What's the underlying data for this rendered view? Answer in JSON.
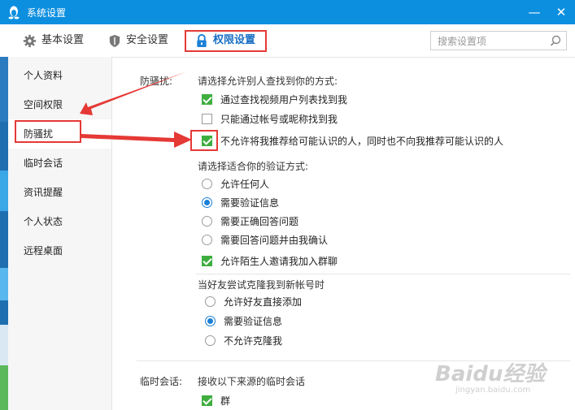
{
  "window": {
    "title": "系统设置",
    "minimize_glyph": "—",
    "close_glyph": "✕"
  },
  "toolbar": {
    "tabs": [
      {
        "label": "基本设置",
        "icon": "gear-icon"
      },
      {
        "label": "安全设置",
        "icon": "shield-icon"
      },
      {
        "label": "权限设置",
        "icon": "lock-icon"
      }
    ],
    "active_tab": 2
  },
  "search": {
    "placeholder": "搜索设置项",
    "value": ""
  },
  "sidebar": {
    "items": [
      {
        "label": "个人资料"
      },
      {
        "label": "空间权限"
      },
      {
        "label": "防骚扰"
      },
      {
        "label": "临时会话"
      },
      {
        "label": "资讯提醒"
      },
      {
        "label": "个人状态"
      },
      {
        "label": "远程桌面"
      }
    ],
    "selected": 2
  },
  "anti_harass": {
    "section_label": "防骚扰:",
    "find_prompt": "请选择允许别人查找到你的方式:",
    "find_options": [
      {
        "label": "通过查找视频用户列表找到我",
        "checked": true
      },
      {
        "label": "只能通过帐号或昵称找到我",
        "checked": false
      },
      {
        "label": "不允许将我推荐给可能认识的人，同时也不向我推荐可能认识的人",
        "checked": true
      }
    ],
    "verify_prompt": "请选择适合你的验证方式:",
    "verify_options": [
      {
        "label": "允许任何人",
        "selected": false
      },
      {
        "label": "需要验证信息",
        "selected": true
      },
      {
        "label": "需要正确回答问题",
        "selected": false
      },
      {
        "label": "需要回答问题并由我确认",
        "selected": false
      }
    ],
    "group_invite": {
      "label": "允许陌生人邀请我加入群聊",
      "checked": true
    },
    "clone_prompt": "当好友尝试克隆我到新帐号时",
    "clone_options": [
      {
        "label": "允许好友直接添加",
        "selected": false
      },
      {
        "label": "需要验证信息",
        "selected": true
      },
      {
        "label": "不允许克隆我",
        "selected": false
      }
    ]
  },
  "temp_chat": {
    "section_label": "临时会话:",
    "prompt": "接收以下来源的临时会话",
    "options": [
      {
        "label": "群",
        "checked": true
      }
    ]
  },
  "watermark": {
    "brand": "Baidu经验",
    "url": "jingyan.baidu.com"
  },
  "colors": {
    "titlebar": "#0d8fe0",
    "accent": "#1a6fc4",
    "annotation_red": "#e53935",
    "check_green": "#3fae3f"
  }
}
